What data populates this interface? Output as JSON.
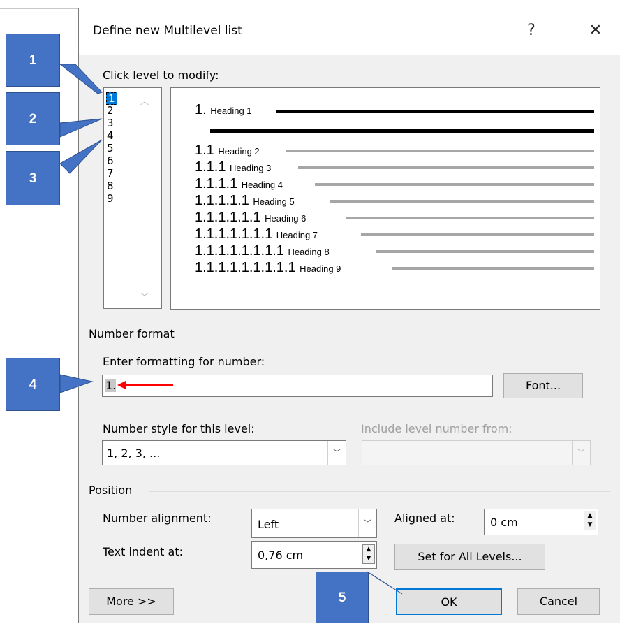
{
  "dialog": {
    "title": "Define new Multilevel list",
    "help_glyph": "?",
    "close_glyph": "✕"
  },
  "levels": {
    "label": "Click level to modify:",
    "items": [
      "1",
      "2",
      "3",
      "4",
      "5",
      "6",
      "7",
      "8",
      "9"
    ],
    "selected": "1"
  },
  "preview": {
    "rows": [
      {
        "num": "1.",
        "heading": "Heading 1"
      },
      {
        "num": "1.1",
        "heading": "Heading 2"
      },
      {
        "num": "1.1.1",
        "heading": "Heading 3"
      },
      {
        "num": "1.1.1.1",
        "heading": "Heading 4"
      },
      {
        "num": "1.1.1.1.1",
        "heading": "Heading 5"
      },
      {
        "num": "1.1.1.1.1.1",
        "heading": "Heading 6"
      },
      {
        "num": "1.1.1.1.1.1.1",
        "heading": "Heading 7"
      },
      {
        "num": "1.1.1.1.1.1.1.1",
        "heading": "Heading 8"
      },
      {
        "num": "1.1.1.1.1.1.1.1.1",
        "heading": "Heading 9"
      }
    ]
  },
  "number_format": {
    "group_label": "Number format",
    "enter_label": "Enter formatting for number:",
    "value": "1.",
    "font_button": "Font...",
    "style_label": "Number style for this level:",
    "style_value": "1, 2, 3, ...",
    "include_label": "Include level number from:",
    "include_value": ""
  },
  "position": {
    "group_label": "Position",
    "alignment_label": "Number alignment:",
    "alignment_value": "Left",
    "aligned_at_label": "Aligned at:",
    "aligned_at_value": "0 cm",
    "indent_label": "Text indent at:",
    "indent_value": "0,76 cm",
    "set_all_button": "Set for All Levels..."
  },
  "footer": {
    "more_button": "More >>",
    "ok_button": "OK",
    "cancel_button": "Cancel"
  },
  "callouts": [
    "1",
    "2",
    "3",
    "4",
    "5"
  ],
  "colors": {
    "callout_fill": "#4472c4",
    "selection": "#0078d7",
    "arrow": "#ff0000"
  }
}
